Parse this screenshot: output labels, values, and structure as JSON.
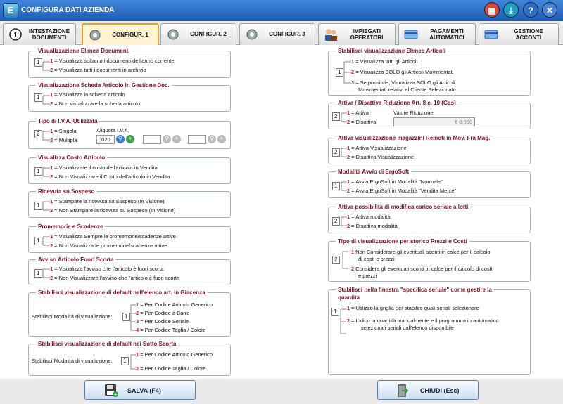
{
  "window": {
    "title": "CONFIGURA DATI AZIENDA",
    "app_icon": "E"
  },
  "tabs": [
    {
      "label": "INTESTAZIONE DOCUMENTI",
      "icon": "number-one-icon"
    },
    {
      "label": "CONFIGUR. 1",
      "icon": "gear-icon"
    },
    {
      "label": "CONFIGUR. 2",
      "icon": "gear-icon"
    },
    {
      "label": "CONFIGUR. 3",
      "icon": "gear-icon"
    },
    {
      "label": "IMPIEGATI OPERATORI",
      "icon": "people-icon"
    },
    {
      "label": "PAGAMENTI AUTOMATICI",
      "icon": "card-icon"
    },
    {
      "label": "GESTIONE ACCONTI",
      "icon": "card-icon"
    }
  ],
  "left": {
    "elenco_doc": {
      "title": "Visualizzazione Elenco Documenti",
      "value": "1",
      "o1": "= Visualizza soltanto i documenti dell'anno corrente",
      "o2": "= Visualizza tutti i documenti in archivio"
    },
    "scheda_art": {
      "title": "Visualizzazione Scheda Articolo In Gestione Doc.",
      "value": "1",
      "o1": "= Visualizza  la scheda articolo",
      "o2": "= Non visualizzare la scheda articolo"
    },
    "iva": {
      "title": "Tipo di  I.V.A. Utilizzata",
      "value": "2",
      "o1": "= Singola",
      "o2": "= Multipla",
      "aliquota_label": "Aliquota I.V.A.",
      "aliquota_value": "0020"
    },
    "costo": {
      "title": "Visualizza Costo Articolo",
      "value": "1",
      "o1": "= Visualizzare il costo dell'articolo in Vendita",
      "o2": "= Non Visualizzare il Costo dell'articolo in Vendita"
    },
    "ricevuta": {
      "title": "Ricevuta su Sospeso",
      "value": "1",
      "o1": "= Stampare la ricevuta  su Sospeso (In Visione)",
      "o2": "= Non Stampare la ricevuta  su Sospeso (In Visione)"
    },
    "promemorie": {
      "title": "Promemorie e Scadenze",
      "value": "1",
      "o1": "= Visualizza Sempre le promemorie/scadenze attive",
      "o2": "= Non Visualizza le promemorie/scadenze attive"
    },
    "fuori_scorta": {
      "title": "Avviso Articolo Fuori Scorta",
      "value": "1",
      "o1": "= Visualizza l'avviso che l'articolo è fuori scorta",
      "o2": "= Non Visualizzare l'avviso che l'articolo è fuori scorta"
    },
    "giacenza": {
      "title": "Stabilisci visualizzazione di default nell'elenco art. in Giacenza",
      "label": "Stabilisci Modalità di visualizzione:",
      "value": "1",
      "o1": "= Per Codice Articolo Generico",
      "o2": "= Per Codice a Barre",
      "o3": "= Per Codice Seriale",
      "o4": "= Per Codice Taglia / Colore"
    },
    "sotto_scorta": {
      "title": "Stabilisci visualizzazione di default nei Sotto Scorta",
      "label": "Stabilisci Modalità di visualizzione:",
      "value": "1",
      "o1": "= Per Codice Articolo Generico",
      "o2": "= Per Codice Taglia / Colore"
    }
  },
  "right": {
    "elenco_art": {
      "title": "Stabilisci visualizzazione Elenco Articoli",
      "value": "1",
      "o1": "= Visualizza tutti gli Articoli",
      "o2": "= Visualizza SOLO gli Articoli Movimentati",
      "o3a": "= Se possibile, Visualizza SOLO gli Articoli",
      "o3b": "Movimentati relativi al Cliente Selezionato"
    },
    "gas": {
      "title": "Attiva / Disattiva Riduzione Art. 8 c. 10 (Gas)",
      "value": "2",
      "o1": "= Attiva",
      "o2": "= Disattiva",
      "rid_label": "Valore Riduzione",
      "rid_value": "€ 0,000"
    },
    "magazzini": {
      "title": "Attiva visualizzazione magazzini Remoti in Mov. Fra Mag.",
      "value": "2",
      "o1": "= Attiva Visualizzazione",
      "o2": "= Disattiva Visualizzazione"
    },
    "avvio": {
      "title": "Modalità Avvio di ErgoSoft",
      "value": "1",
      "o1": "= Avvia ErgoSoft in Modalità \"Normale\"",
      "o2": "= Avvia ErgoSoft in Modalità \"Vendita Merce\""
    },
    "seriale": {
      "title": "Attiva possibilità di modifica carico seriale a lotti",
      "value": "2",
      "o1": "= Attiva modalità",
      "o2": "= Disattiva modalità"
    },
    "storico": {
      "title": "Tipo di visualizzazione  per storico  Prezzi e Costi",
      "value": "2",
      "o1a": "Non Considerare gli eventuali sconti in calce per il calcolo",
      "o1b": "di costi e prezzi",
      "o2a": "Considera gli eventuali sconti in calce per il calcolo di costi",
      "o2b": "e prezzi"
    },
    "finestra": {
      "title1": "Stabilisci nella finestra \"specifica seriale\"  come gestire la",
      "title2": "quantità",
      "value": "1",
      "o1": "= Utilizzo la griglia per stabilire quali seriali selezionare",
      "o2a": "= Indico la quantità manualmente e il programma in automatico",
      "o2b": "seleziona i seriali dall'elenco disponibile"
    }
  },
  "buttons": {
    "save": "SALVA (F4)",
    "close": "CHIUDI  (Esc)"
  }
}
